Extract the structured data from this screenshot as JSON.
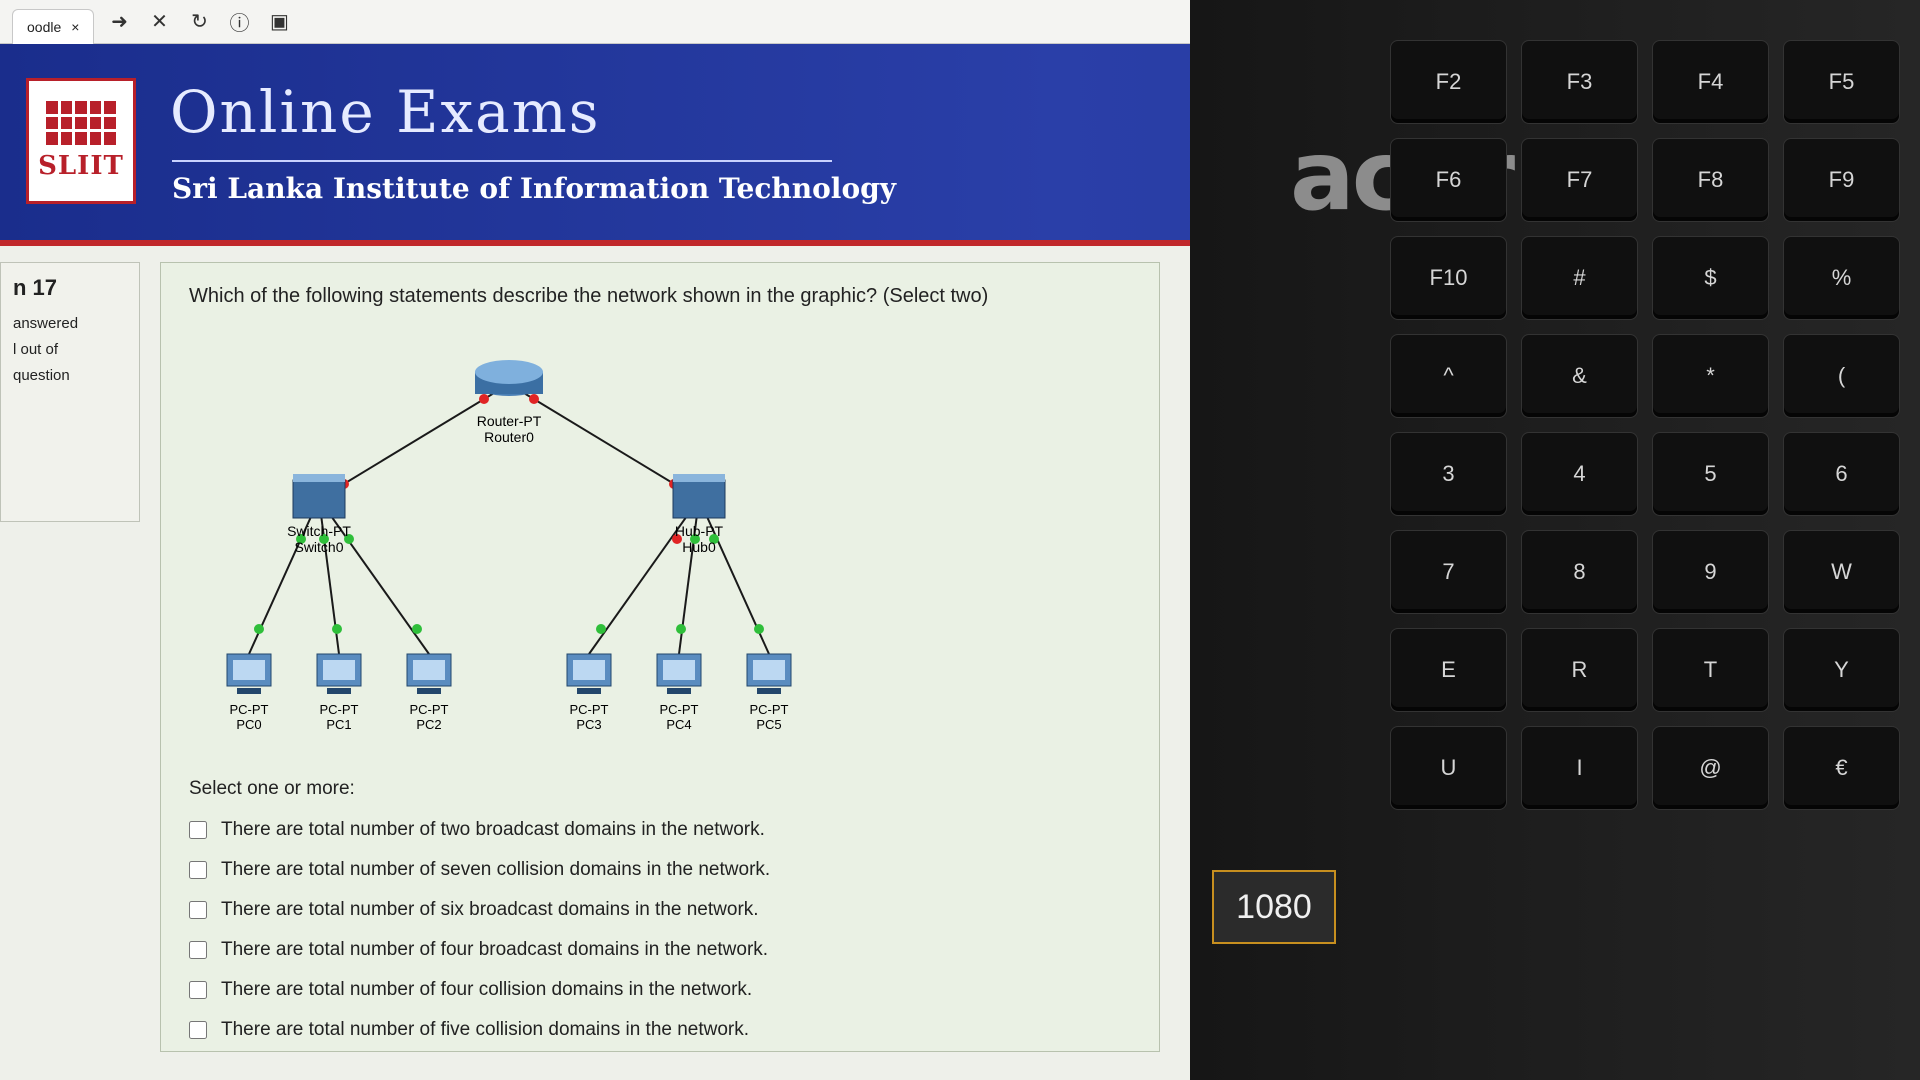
{
  "browser": {
    "tab_title": "oodle",
    "tab_close": "×"
  },
  "banner": {
    "logo_text": "SLIIT",
    "title": "Online Exams",
    "subtitle": "Sri Lanka Institute of Information Technology"
  },
  "info_panel": {
    "question_number": "n 17",
    "status": "answered",
    "marks": "l out of",
    "flag": "question"
  },
  "question": {
    "text": "Which of the following statements describe the network shown in the graphic? (Select two)",
    "select_label": "Select one or more:",
    "answers": [
      "There are total number of two broadcast domains in the network.",
      "There are total number of seven collision domains in the network.",
      "There are total number of six broadcast domains in the network.",
      "There are total number of four broadcast domains in the network.",
      "There are total number of four collision domains in the network.",
      "There are total number of five collision domains in the network."
    ]
  },
  "diagram": {
    "router_type": "Router-PT",
    "router_name": "Router0",
    "switch_type": "Switch-PT",
    "switch_name": "Switch0",
    "hub_type": "Hub-PT",
    "hub_name": "Hub0",
    "pc_type": "PC-PT",
    "pcs": [
      "PC0",
      "PC1",
      "PC2",
      "PC3",
      "PC4",
      "PC5"
    ],
    "link_up_color": "#2fbf3a",
    "link_down_color": "#e02424"
  },
  "laptop": {
    "brand": "acer",
    "sticker": "1080",
    "keys": [
      "F2",
      "F3",
      "F4",
      "F5",
      "F6",
      "F7",
      "F8",
      "F9",
      "F10",
      "#",
      "$",
      "%",
      "^",
      "&",
      "*",
      "(",
      "3",
      "4",
      "5",
      "6",
      "7",
      "8",
      "9",
      "W",
      "E",
      "R",
      "T",
      "Y",
      "U",
      "I",
      "@",
      "€"
    ]
  }
}
